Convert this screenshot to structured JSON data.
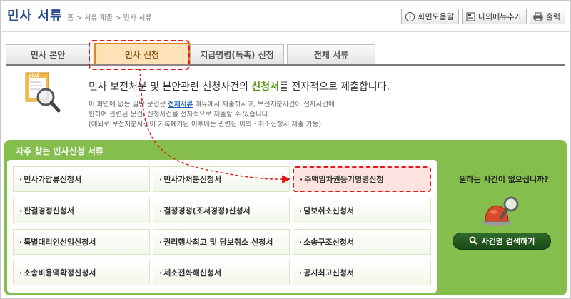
{
  "header": {
    "title": "민사 서류",
    "breadcrumb": "홈 > 서류 제출 > 민사 서류",
    "buttons": [
      {
        "label": "화면도움말",
        "icon": "info-icon"
      },
      {
        "label": "나의메뉴추가",
        "icon": "bookmark-icon"
      },
      {
        "label": "출력",
        "icon": "printer-icon"
      }
    ]
  },
  "tabs": [
    {
      "label": "민사 본안",
      "active": false
    },
    {
      "label": "민사 신청",
      "active": true
    },
    {
      "label": "지급명령(독촉) 신청",
      "active": false
    },
    {
      "label": "전체 서류",
      "active": false
    }
  ],
  "intro": {
    "icon_label": "민사",
    "title_before": "민사 보전처분 및 본안관련 신청사건의 ",
    "title_highlight": "신청서",
    "title_after": "를 전자적으로 제출합니다.",
    "line1_before": "이 화면에 없는 일반 문건은 ",
    "line1_link": "전체서류",
    "line1_after": " 메뉴에서 제출하시고, 보전처분사건이 전자사건에",
    "line2": "한하여 관련된 문건, 신청사건을 전자적으로 제출할 수 있습니다.",
    "line3": "(예외로 보전처분사건이 기록폐기된 이후에는 관련된 이의 · 취소신청서 제출 가능)"
  },
  "panel": {
    "title": "자주 찾는 민사신청 서류",
    "bullet": "·",
    "items": [
      {
        "label": "민사가압류신청서"
      },
      {
        "label": "민사가처분신청서"
      },
      {
        "label": "주택임차권등기명령신청",
        "marked": true
      },
      {
        "label": "판결경정신청서"
      },
      {
        "label": "결정경정(조서경정)신청서"
      },
      {
        "label": "담보취소신청서"
      },
      {
        "label": "특별대리인선임신청서"
      },
      {
        "label": "권리행사최고 및 담보취소 신청서"
      },
      {
        "label": "소송구조신청서"
      },
      {
        "label": "소송비용액확정신청서"
      },
      {
        "label": "제소전화해신청서"
      },
      {
        "label": "공시최고신청서"
      }
    ],
    "side_question": "원하는 사건이 없으십니까?",
    "search_button": "사건명 검색하기"
  },
  "colors": {
    "panel_green": "#86be4e",
    "title_blue": "#2b4d8f",
    "highlight_red": "#e21a1a",
    "active_tab": "#fde6b4"
  }
}
